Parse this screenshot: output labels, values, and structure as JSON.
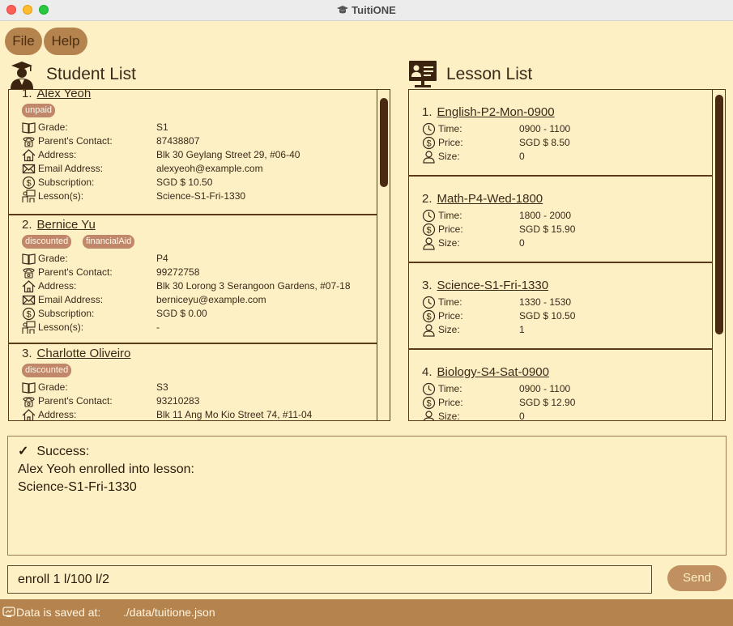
{
  "window": {
    "title": "TuitiONE"
  },
  "menu": {
    "file": "File",
    "help": "Help"
  },
  "student_panel": {
    "title": "Student List",
    "labels": {
      "grade": "Grade:",
      "contact": "Parent's Contact:",
      "address": "Address:",
      "email": "Email Address:",
      "subscription": "Subscription:",
      "lessons": "Lesson(s):"
    },
    "students": [
      {
        "index": "1.",
        "name": "Alex Yeoh",
        "tags": [
          "unpaid"
        ],
        "grade": "S1",
        "contact": "87438807",
        "address": "Blk 30 Geylang Street 29, #06-40",
        "email": "alexyeoh@example.com",
        "subscription": "SGD $ 10.50",
        "lessons": "Science-S1-Fri-1330"
      },
      {
        "index": "2.",
        "name": "Bernice Yu",
        "tags": [
          "discounted",
          "financialAid"
        ],
        "grade": "P4",
        "contact": "99272758",
        "address": "Blk 30 Lorong 3 Serangoon Gardens, #07-18",
        "email": "berniceyu@example.com",
        "subscription": "SGD $ 0.00",
        "lessons": "-"
      },
      {
        "index": "3.",
        "name": "Charlotte Oliveiro",
        "tags": [
          "discounted"
        ],
        "grade": "S3",
        "contact": "93210283",
        "address": "Blk 11 Ang Mo Kio Street 74, #11-04"
      }
    ]
  },
  "lesson_panel": {
    "title": "Lesson List",
    "labels": {
      "time": "Time:",
      "price": "Price:",
      "size": "Size:"
    },
    "lessons": [
      {
        "index": "1.",
        "name": "English-P2-Mon-0900",
        "time": "0900 - 1100",
        "price": "SGD $ 8.50",
        "size": "0"
      },
      {
        "index": "2.",
        "name": "Math-P4-Wed-1800",
        "time": "1800 - 2000",
        "price": "SGD $ 15.90",
        "size": "0"
      },
      {
        "index": "3.",
        "name": "Science-S1-Fri-1330",
        "time": "1330 - 1530",
        "price": "SGD $ 10.50",
        "size": "1"
      },
      {
        "index": "4.",
        "name": "Biology-S4-Sat-0900",
        "time": "0900 - 1100",
        "price": "SGD $ 12.90",
        "size": "0"
      }
    ]
  },
  "result": {
    "check": "✓",
    "status": "Success:",
    "message_line1": "Alex Yeoh enrolled into lesson:",
    "message_line2": "Science-S1-Fri-1330"
  },
  "command": {
    "value": "enroll 1 l/100 l/2",
    "send_label": "Send"
  },
  "status_bar": {
    "label": "Data is saved at:",
    "path": "./data/tuitione.json"
  },
  "icons": {
    "grade": "book-icon",
    "contact": "phone-icon",
    "address": "house-icon",
    "email": "envelope-icon",
    "subscription": "dollar-icon",
    "lessons": "class-icon",
    "time": "clock-icon",
    "price": "dollar-icon",
    "size": "person-icon"
  },
  "colors": {
    "background": "#fdf0c4",
    "accent": "#b5834e",
    "tag": "#c0876a",
    "border": "#5a3a1a"
  }
}
